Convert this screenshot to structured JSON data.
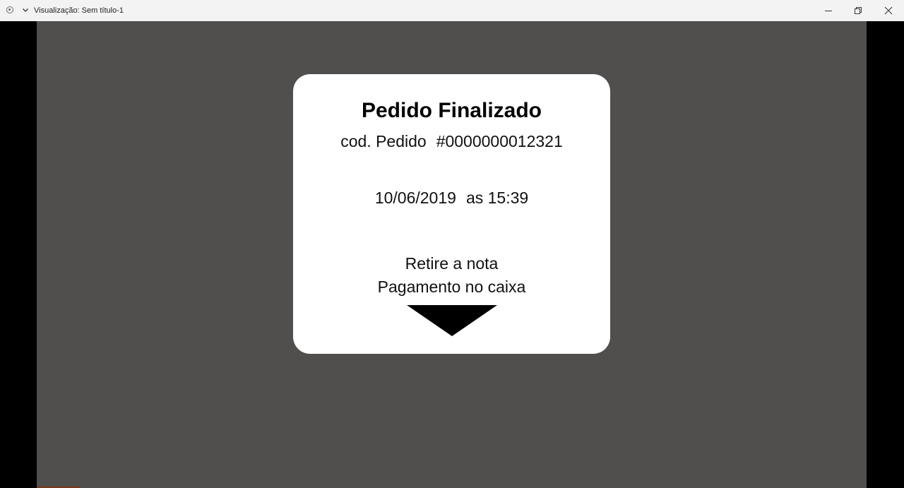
{
  "window": {
    "title": "Visualização: Sem título-1",
    "app_icon": "record-icon",
    "menu_icon": "chevron-down-icon",
    "controls": {
      "minimize_icon": "minimize-icon",
      "maximize_icon": "restore-icon",
      "close_icon": "close-icon"
    }
  },
  "card": {
    "title": "Pedido Finalizado",
    "order_label": "cod. Pedido",
    "order_number": "#0000000012321",
    "date": "10/06/2019",
    "time_prefix": "as 15:39",
    "instruction_1": "Retire a nota",
    "instruction_2": "Pagamento no caixa",
    "arrow_icon": "down-triangle-icon"
  },
  "colors": {
    "titlebar": "#f3f3f3",
    "canvas": "#504f4d",
    "card": "#ffffff",
    "side_bars": "#000000"
  }
}
